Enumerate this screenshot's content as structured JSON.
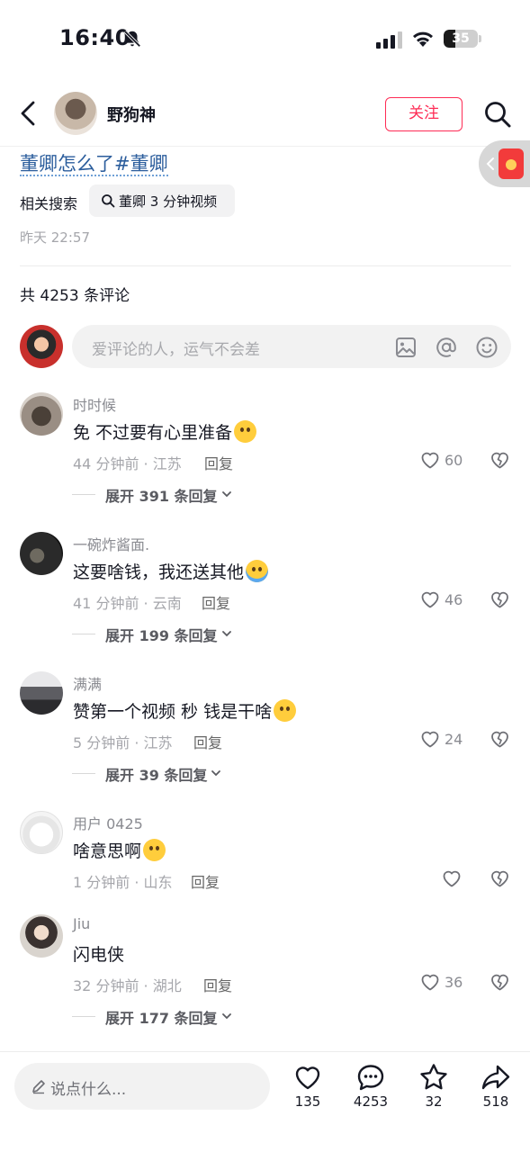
{
  "status_bar": {
    "time": "16:40",
    "battery": "35",
    "battery_level": 0.35,
    "icons": [
      "bell-slash-icon",
      "signal-icon",
      "wifi-icon",
      "battery-icon"
    ]
  },
  "header": {
    "username": "野狗神",
    "follow_label": "关注",
    "icons": [
      "back-chevron-icon",
      "search-icon"
    ]
  },
  "caption": {
    "hashtags": "董卿怎么了#董卿",
    "related_label": "相关搜索",
    "related_query": "董卿 3 分钟视频",
    "post_time": "昨天 22:57"
  },
  "comments_header": {
    "count_text": "共 4253 条评论",
    "input_placeholder": "爱评论的人，运气不会差",
    "input_icons": [
      "image-icon",
      "at-icon",
      "emoji-icon"
    ]
  },
  "comments": [
    {
      "user": "时时候",
      "text": "免 不过要有心里准备",
      "time_location": "44 分钟前 · 江苏",
      "reply": "回复",
      "likes": "60",
      "expand": "展开 391 条回复"
    },
    {
      "user": "一碗炸酱面.",
      "text": "这要啥钱，我还送其他",
      "time_location": "41 分钟前 · 云南",
      "reply": "回复",
      "likes": "46",
      "expand": "展开 199 条回复"
    },
    {
      "user": "满满",
      "text": "赞第一个视频 秒  钱是干啥",
      "time_location": "5 分钟前 · 江苏",
      "reply": "回复",
      "likes": "24",
      "expand": "展开 39 条回复"
    },
    {
      "user": "用户 0425",
      "text": "啥意思啊",
      "time_location": "1 分钟前 · 山东",
      "reply": "回复",
      "likes": "",
      "expand": ""
    },
    {
      "user": "Jiu",
      "text": "闪电侠",
      "time_location": "32 分钟前 · 湖北",
      "reply": "回复",
      "likes": "36",
      "expand": "展开 177 条回复"
    }
  ],
  "bottom_bar": {
    "input_placeholder": "说点什么...",
    "like_count": "135",
    "comment_count": "4253",
    "favorite_count": "32",
    "share_count": "518"
  },
  "colors": {
    "accent": "#fe2c55",
    "hashtag": "#2b5d9c",
    "muted": "#a5a6ab"
  }
}
